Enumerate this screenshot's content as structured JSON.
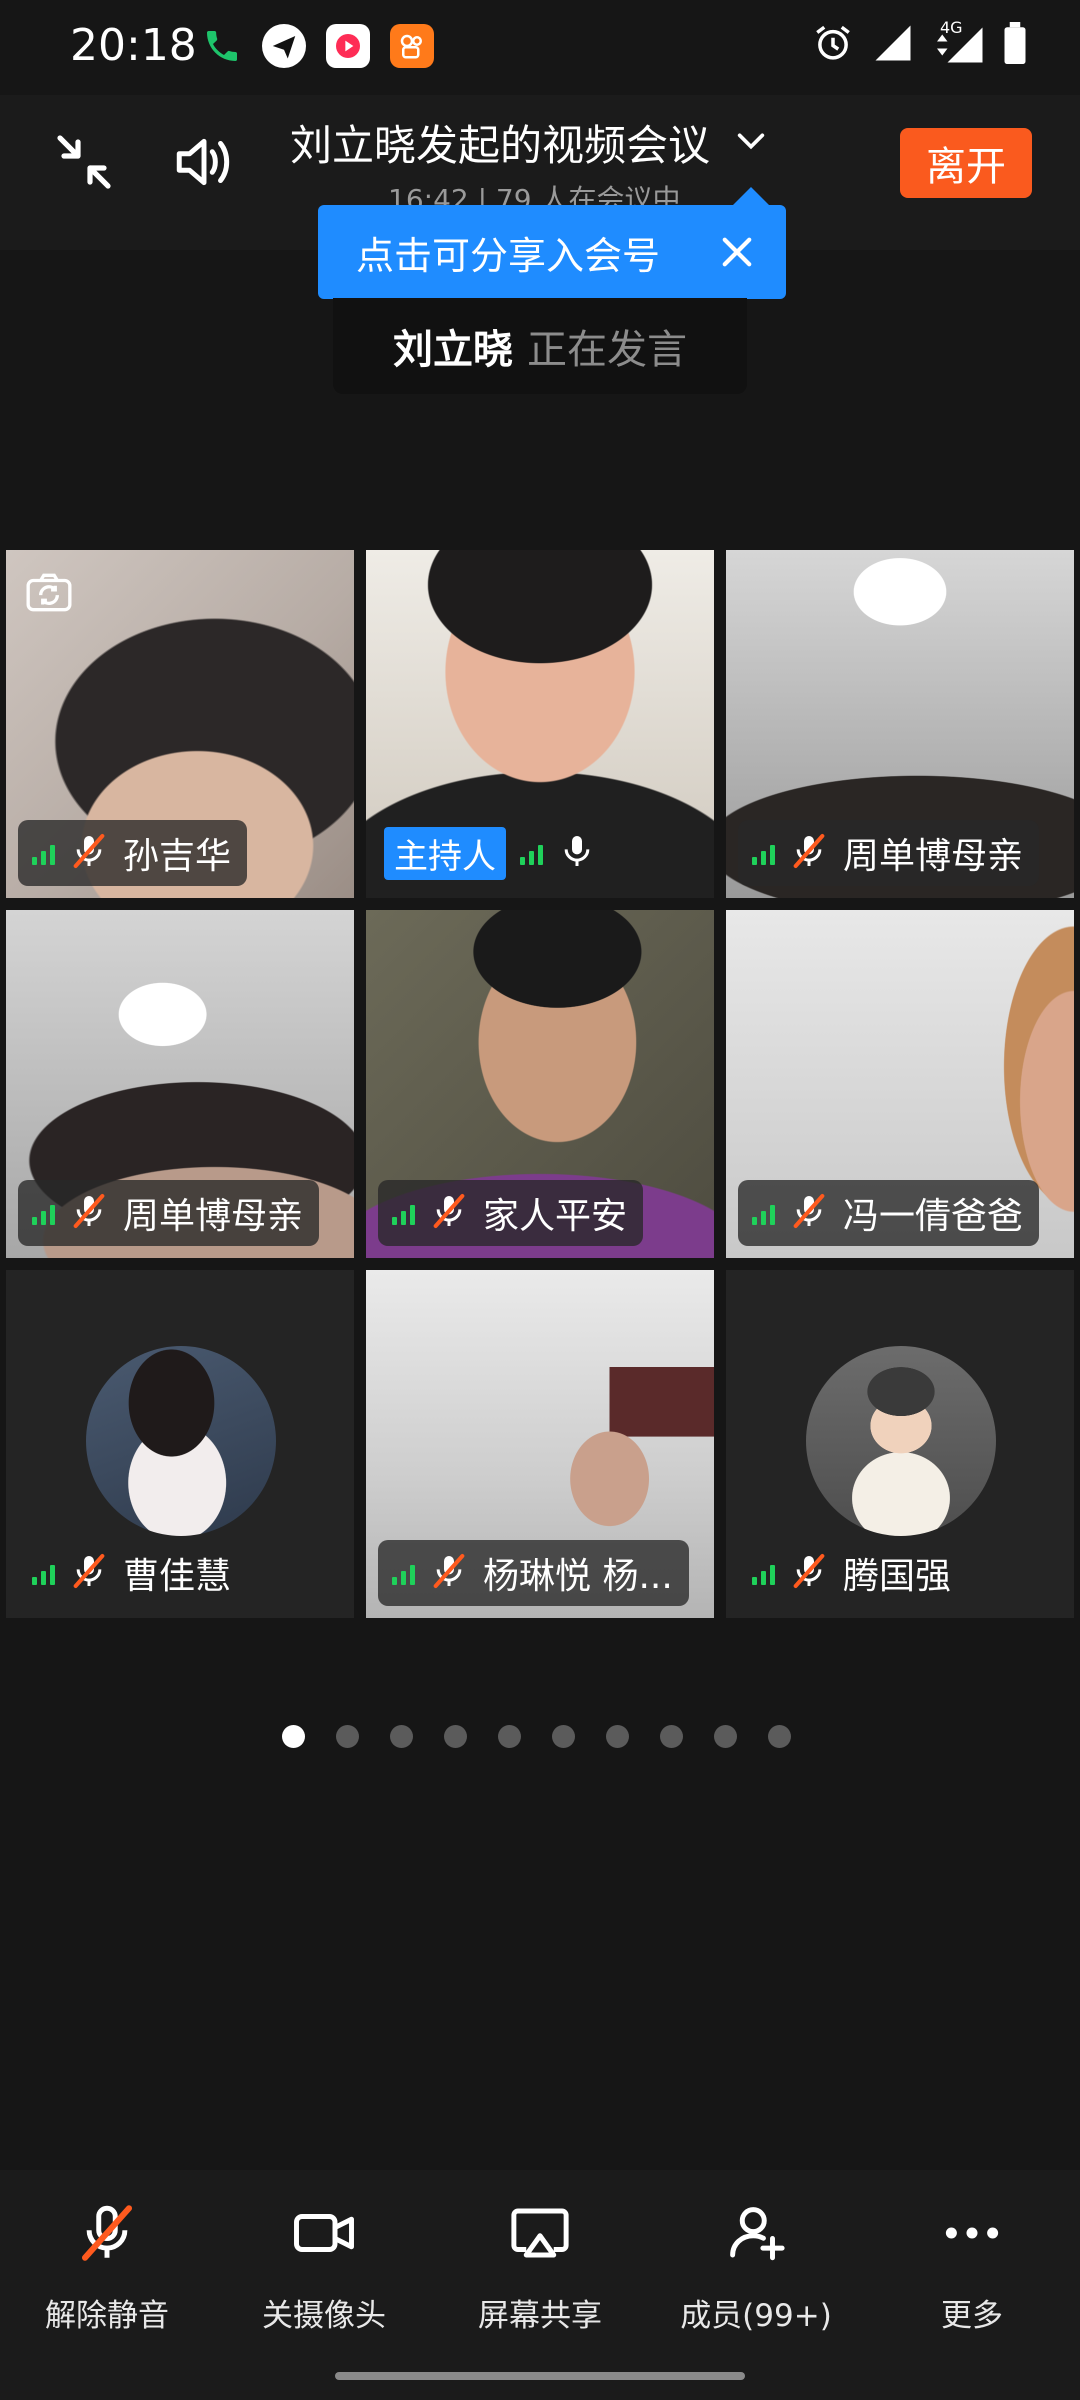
{
  "status_bar": {
    "time": "20:18",
    "network": "4G",
    "icons": [
      "phone-icon",
      "app-icon",
      "video-app-icon",
      "kuaishou-icon",
      "alarm-icon",
      "signal-icon",
      "battery-icon"
    ]
  },
  "header": {
    "title": "刘立晓发起的视频会议",
    "subtitle": "16:42 | 79 人在会议中",
    "leave_label": "离开"
  },
  "tooltip": {
    "text": "点击可分享入会号"
  },
  "speaker": {
    "name": "刘立晓",
    "state": "正在发言"
  },
  "host_badge": "主持人",
  "participants": [
    {
      "name": "孙吉华",
      "muted": true
    },
    {
      "name": "",
      "muted": false,
      "host": true
    },
    {
      "name": "周单博母亲",
      "muted": true
    },
    {
      "name": "周单博母亲",
      "muted": true
    },
    {
      "name": "家人平安",
      "muted": true
    },
    {
      "name": "冯一倩爸爸",
      "muted": true
    },
    {
      "name": "曹佳慧",
      "muted": true
    },
    {
      "name": "杨琳悦 杨...",
      "muted": true
    },
    {
      "name": "腾国强",
      "muted": true
    }
  ],
  "pagination": {
    "total": 10,
    "current": 1
  },
  "toolbar": {
    "unmute": "解除静音",
    "camera_off": "关摄像头",
    "screen_share": "屏幕共享",
    "members": "成员(99+)",
    "more": "更多"
  },
  "colors": {
    "accent": "#1f8cff",
    "leave": "#fa5a1e",
    "host_border": "#19b14a",
    "mute_slash": "#ff5a1e",
    "signal": "#1fd15a"
  }
}
